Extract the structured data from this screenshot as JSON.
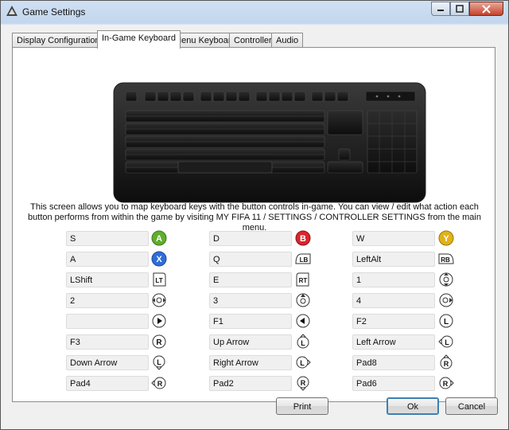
{
  "window": {
    "title": "Game Settings"
  },
  "tabs": [
    "Display Configuration",
    "In-Game Keyboard",
    "Menu Keyboard",
    "Controller",
    "Audio"
  ],
  "active_tab": "In-Game Keyboard",
  "instructions": "This screen allows you to map keyboard keys with the button controls in-game. You can view / edit what action each button performs from within the game by visiting MY FIFA 11 / SETTINGS / CONTROLLER SETTINGS from the main menu.",
  "mappings": {
    "col1": [
      {
        "key": "S",
        "icon": "a-button-icon",
        "glyph": "A"
      },
      {
        "key": "A",
        "icon": "x-button-icon",
        "glyph": "X"
      },
      {
        "key": "LShift",
        "icon": "lt-trigger-icon",
        "glyph": "LT"
      },
      {
        "key": "2",
        "icon": "dpad-left-right-icon",
        "glyph": ""
      },
      {
        "key": "",
        "icon": "start-button-icon",
        "glyph": "▶"
      },
      {
        "key": "F3",
        "icon": "right-stick-click-icon",
        "glyph": "R"
      },
      {
        "key": "Down Arrow",
        "icon": "left-stick-down-icon",
        "glyph": "L"
      },
      {
        "key": "Pad4",
        "icon": "right-stick-left-icon",
        "glyph": "R"
      }
    ],
    "col2": [
      {
        "key": "D",
        "icon": "b-button-icon",
        "glyph": "B"
      },
      {
        "key": "Q",
        "icon": "lb-bumper-icon",
        "glyph": "LB"
      },
      {
        "key": "E",
        "icon": "rt-trigger-icon",
        "glyph": "RT"
      },
      {
        "key": "3",
        "icon": "dpad-up-icon",
        "glyph": ""
      },
      {
        "key": "F1",
        "icon": "back-button-icon",
        "glyph": "◀"
      },
      {
        "key": "Up Arrow",
        "icon": "left-stick-up-icon",
        "glyph": "L"
      },
      {
        "key": "Right Arrow",
        "icon": "left-stick-right-icon",
        "glyph": "L"
      },
      {
        "key": "Pad2",
        "icon": "right-stick-down-icon",
        "glyph": "R"
      }
    ],
    "col3": [
      {
        "key": "W",
        "icon": "y-button-icon",
        "glyph": "Y"
      },
      {
        "key": "LeftAlt",
        "icon": "rb-bumper-icon",
        "glyph": "RB"
      },
      {
        "key": "1",
        "icon": "dpad-up-down-icon",
        "glyph": ""
      },
      {
        "key": "4",
        "icon": "dpad-right-icon",
        "glyph": ""
      },
      {
        "key": "F2",
        "icon": "left-stick-click-icon",
        "glyph": "L"
      },
      {
        "key": "Left Arrow",
        "icon": "left-stick-left-icon",
        "glyph": "L"
      },
      {
        "key": "Pad8",
        "icon": "right-stick-up-icon",
        "glyph": "R"
      },
      {
        "key": "Pad6",
        "icon": "right-stick-right-icon",
        "glyph": "R"
      }
    ]
  },
  "buttons": {
    "print": "Print",
    "ok": "Ok",
    "cancel": "Cancel"
  },
  "colors": {
    "a_button": "#5fae2e",
    "b_button": "#d8262b",
    "x_button": "#2f6ed8",
    "y_button": "#e0b21a"
  }
}
